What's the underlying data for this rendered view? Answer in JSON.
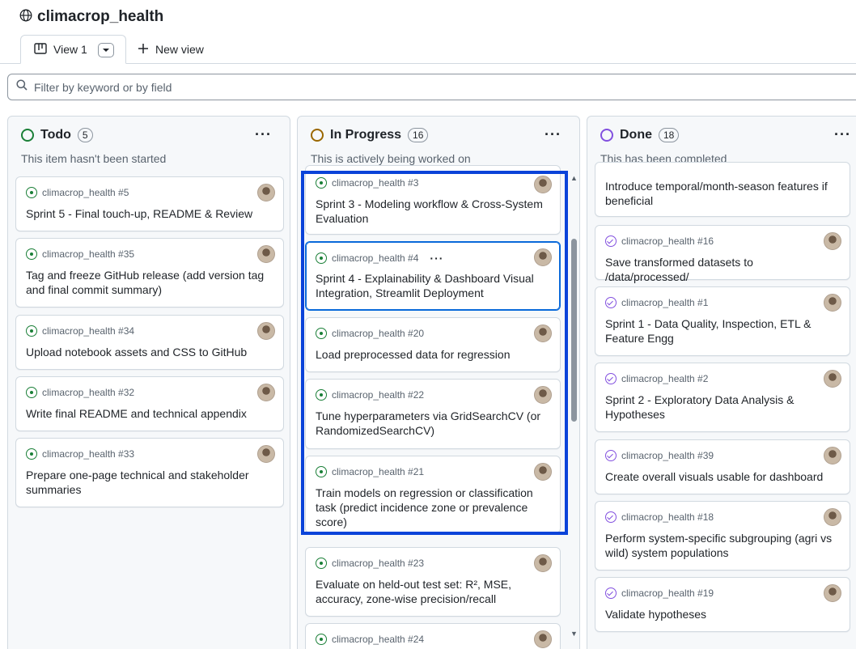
{
  "project": {
    "title": "climacrop_health",
    "icon": "globe-icon"
  },
  "tabs": {
    "active_label": "View 1",
    "new_view_label": "New view"
  },
  "filter": {
    "placeholder": "Filter by keyword or by field"
  },
  "colors": {
    "todo": "#1a7f37",
    "in_progress": "#9a6700",
    "done": "#8250df",
    "selection": "#0a43d9"
  },
  "columns": {
    "todo": {
      "title": "Todo",
      "count": "5",
      "description": "This item hasn't been started",
      "cards": [
        {
          "ref": "climacrop_health #5",
          "title": "Sprint 5 - Final touch-up, README & Review"
        },
        {
          "ref": "climacrop_health #35",
          "title": "Tag and freeze GitHub release (add version tag and final commit summary)"
        },
        {
          "ref": "climacrop_health #34",
          "title": "Upload notebook assets and CSS to GitHub"
        },
        {
          "ref": "climacrop_health #32",
          "title": "Write final README and technical appendix"
        },
        {
          "ref": "climacrop_health #33",
          "title": "Prepare one-page technical and stakeholder summaries"
        }
      ]
    },
    "in_progress": {
      "title": "In Progress",
      "count": "16",
      "description": "This is actively being worked on",
      "cards": [
        {
          "ref": "climacrop_health #3",
          "title": "Sprint 3 - Modeling workflow & Cross-System Evaluation"
        },
        {
          "ref": "climacrop_health #4",
          "title": "Sprint 4 - Explainability & Dashboard Visual Integration, Streamlit Deployment"
        },
        {
          "ref": "climacrop_health #20",
          "title": "Load preprocessed data for regression"
        },
        {
          "ref": "climacrop_health #22",
          "title": "Tune hyperparameters via GridSearchCV (or RandomizedSearchCV)"
        },
        {
          "ref": "climacrop_health #21",
          "title": "Train models on regression or classification task (predict incidence zone or prevalence score)"
        },
        {
          "ref": "climacrop_health #23",
          "title": "Evaluate on held-out test set: R², MSE, accuracy, zone-wise precision/recall"
        },
        {
          "ref": "climacrop_health #24",
          "title": ""
        }
      ]
    },
    "done": {
      "title": "Done",
      "count": "18",
      "description": "This has been completed",
      "cards": [
        {
          "ref": "",
          "title": "Introduce temporal/month-season features if beneficial"
        },
        {
          "ref": "climacrop_health #16",
          "title": "Save transformed datasets to /data/processed/"
        },
        {
          "ref": "climacrop_health #1",
          "title": "Sprint 1 - Data Quality, Inspection, ETL & Feature Engg"
        },
        {
          "ref": "climacrop_health #2",
          "title": "Sprint 2 - Exploratory Data Analysis & Hypotheses"
        },
        {
          "ref": "climacrop_health #39",
          "title": "Create overall visuals usable for dashboard"
        },
        {
          "ref": "climacrop_health #18",
          "title": "Perform system-specific subgrouping (agri vs wild) system populations"
        },
        {
          "ref": "climacrop_health #19",
          "title": "Validate hypotheses"
        }
      ]
    }
  }
}
